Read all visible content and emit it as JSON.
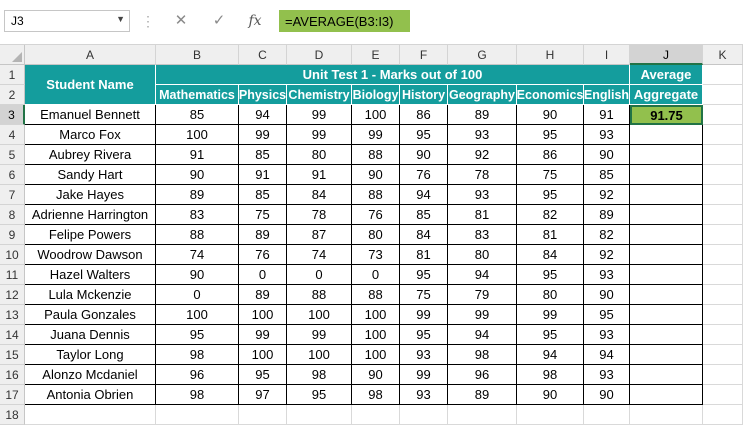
{
  "formula_bar": {
    "name_box": "J3",
    "formula": "=AVERAGE(B3:I3)",
    "cancel_glyph": "✕",
    "enter_glyph": "✓",
    "fx_glyph": "fx"
  },
  "columns": [
    "A",
    "B",
    "C",
    "D",
    "E",
    "F",
    "G",
    "H",
    "I",
    "J",
    "K"
  ],
  "rows": [
    "1",
    "2",
    "3",
    "4",
    "5",
    "6",
    "7",
    "8",
    "9",
    "10",
    "11",
    "12",
    "13",
    "14",
    "15",
    "16",
    "17",
    "18"
  ],
  "table": {
    "student_header": "Student Name",
    "group_header": "Unit Test 1 - Marks out of 100",
    "subjects": [
      "Mathematics",
      "Physics",
      "Chemistry",
      "Biology",
      "History",
      "Geography",
      "Economics",
      "English"
    ],
    "average_header_1": "Average",
    "average_header_2": "Aggregate",
    "average_value": "91.75",
    "students": [
      {
        "name": "Emanuel Bennett",
        "marks": [
          "85",
          "94",
          "99",
          "100",
          "86",
          "89",
          "90",
          "91"
        ]
      },
      {
        "name": "Marco Fox",
        "marks": [
          "100",
          "99",
          "99",
          "99",
          "95",
          "93",
          "95",
          "93"
        ]
      },
      {
        "name": "Aubrey Rivera",
        "marks": [
          "91",
          "85",
          "80",
          "88",
          "90",
          "92",
          "86",
          "90"
        ]
      },
      {
        "name": "Sandy Hart",
        "marks": [
          "90",
          "91",
          "91",
          "90",
          "76",
          "78",
          "75",
          "85"
        ]
      },
      {
        "name": "Jake Hayes",
        "marks": [
          "89",
          "85",
          "84",
          "88",
          "94",
          "93",
          "95",
          "92"
        ]
      },
      {
        "name": "Adrienne Harrington",
        "marks": [
          "83",
          "75",
          "78",
          "76",
          "85",
          "81",
          "82",
          "89"
        ]
      },
      {
        "name": "Felipe Powers",
        "marks": [
          "88",
          "89",
          "87",
          "80",
          "84",
          "83",
          "81",
          "82"
        ]
      },
      {
        "name": "Woodrow Dawson",
        "marks": [
          "74",
          "76",
          "74",
          "73",
          "81",
          "80",
          "84",
          "92"
        ]
      },
      {
        "name": "Hazel Walters",
        "marks": [
          "90",
          "0",
          "0",
          "0",
          "95",
          "94",
          "95",
          "93"
        ]
      },
      {
        "name": "Lula Mckenzie",
        "marks": [
          "0",
          "89",
          "88",
          "88",
          "75",
          "79",
          "80",
          "90"
        ]
      },
      {
        "name": "Paula Gonzales",
        "marks": [
          "100",
          "100",
          "100",
          "100",
          "99",
          "99",
          "99",
          "95"
        ]
      },
      {
        "name": "Juana Dennis",
        "marks": [
          "95",
          "99",
          "99",
          "100",
          "95",
          "94",
          "95",
          "93"
        ]
      },
      {
        "name": "Taylor Long",
        "marks": [
          "98",
          "100",
          "100",
          "100",
          "93",
          "98",
          "94",
          "94"
        ]
      },
      {
        "name": "Alonzo Mcdaniel",
        "marks": [
          "96",
          "95",
          "98",
          "90",
          "99",
          "96",
          "98",
          "93"
        ]
      },
      {
        "name": "Antonia Obrien",
        "marks": [
          "98",
          "97",
          "95",
          "98",
          "93",
          "89",
          "90",
          "90"
        ]
      }
    ]
  }
}
